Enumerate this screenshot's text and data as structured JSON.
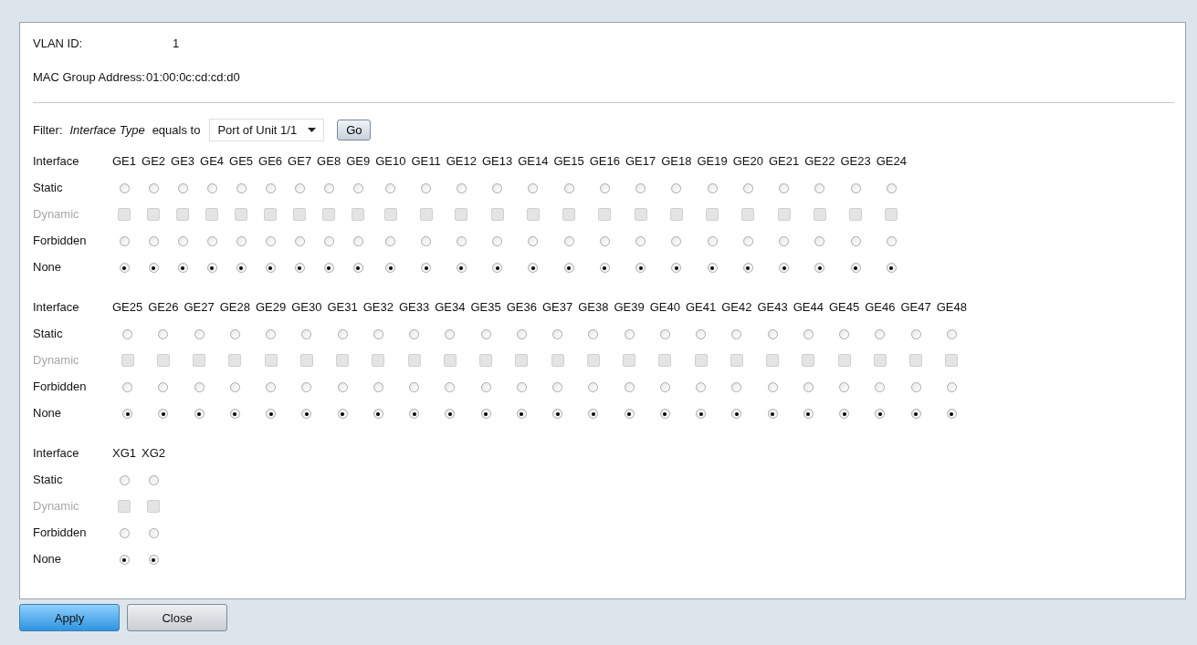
{
  "info": [
    {
      "label": "VLAN ID:",
      "value": "1"
    },
    {
      "label": "MAC Group Address:",
      "value": "01:00:0c:cd:cd:d0"
    }
  ],
  "filter": {
    "label": "Filter:",
    "field": "Interface Type",
    "operator": "equals to",
    "value": "Port of Unit 1/1",
    "button": "Go"
  },
  "groups": [
    {
      "header": "Interface",
      "rows": [
        {
          "label": "Static",
          "disabled": false
        },
        {
          "label": "Dynamic",
          "disabled": true
        },
        {
          "label": "Forbidden",
          "disabled": false
        },
        {
          "label": "None",
          "disabled": false
        }
      ],
      "ports": [
        {
          "name": "GE1",
          "options": [
            false,
            false,
            false,
            true
          ]
        },
        {
          "name": "GE2",
          "options": [
            false,
            false,
            false,
            true
          ]
        },
        {
          "name": "GE3",
          "options": [
            false,
            false,
            false,
            true
          ]
        },
        {
          "name": "GE4",
          "options": [
            false,
            false,
            false,
            true
          ]
        },
        {
          "name": "GE5",
          "options": [
            false,
            false,
            false,
            true
          ]
        },
        {
          "name": "GE6",
          "options": [
            false,
            false,
            false,
            true
          ]
        },
        {
          "name": "GE7",
          "options": [
            false,
            false,
            false,
            true
          ]
        },
        {
          "name": "GE8",
          "options": [
            false,
            false,
            false,
            true
          ]
        },
        {
          "name": "GE9",
          "options": [
            false,
            false,
            false,
            true
          ]
        },
        {
          "name": "GE10",
          "options": [
            false,
            false,
            false,
            true
          ]
        },
        {
          "name": "GE11",
          "options": [
            false,
            false,
            false,
            true
          ]
        },
        {
          "name": "GE12",
          "options": [
            false,
            false,
            false,
            true
          ]
        },
        {
          "name": "GE13",
          "options": [
            false,
            false,
            false,
            true
          ]
        },
        {
          "name": "GE14",
          "options": [
            false,
            false,
            false,
            true
          ]
        },
        {
          "name": "GE15",
          "options": [
            false,
            false,
            false,
            true
          ]
        },
        {
          "name": "GE16",
          "options": [
            false,
            false,
            false,
            true
          ]
        },
        {
          "name": "GE17",
          "options": [
            false,
            false,
            false,
            true
          ]
        },
        {
          "name": "GE18",
          "options": [
            false,
            false,
            false,
            true
          ]
        },
        {
          "name": "GE19",
          "options": [
            false,
            false,
            false,
            true
          ]
        },
        {
          "name": "GE20",
          "options": [
            false,
            false,
            false,
            true
          ]
        },
        {
          "name": "GE21",
          "options": [
            false,
            false,
            false,
            true
          ]
        },
        {
          "name": "GE22",
          "options": [
            false,
            false,
            false,
            true
          ]
        },
        {
          "name": "GE23",
          "options": [
            false,
            false,
            false,
            true
          ]
        },
        {
          "name": "GE24",
          "options": [
            false,
            false,
            false,
            true
          ]
        }
      ]
    },
    {
      "header": "Interface",
      "rows": [
        {
          "label": "Static",
          "disabled": false
        },
        {
          "label": "Dynamic",
          "disabled": true
        },
        {
          "label": "Forbidden",
          "disabled": false
        },
        {
          "label": "None",
          "disabled": false
        }
      ],
      "ports": [
        {
          "name": "GE25",
          "options": [
            false,
            false,
            false,
            true
          ]
        },
        {
          "name": "GE26",
          "options": [
            false,
            false,
            false,
            true
          ]
        },
        {
          "name": "GE27",
          "options": [
            false,
            false,
            false,
            true
          ]
        },
        {
          "name": "GE28",
          "options": [
            false,
            false,
            false,
            true
          ]
        },
        {
          "name": "GE29",
          "options": [
            false,
            false,
            false,
            true
          ]
        },
        {
          "name": "GE30",
          "options": [
            false,
            false,
            false,
            true
          ]
        },
        {
          "name": "GE31",
          "options": [
            false,
            false,
            false,
            true
          ]
        },
        {
          "name": "GE32",
          "options": [
            false,
            false,
            false,
            true
          ]
        },
        {
          "name": "GE33",
          "options": [
            false,
            false,
            false,
            true
          ]
        },
        {
          "name": "GE34",
          "options": [
            false,
            false,
            false,
            true
          ]
        },
        {
          "name": "GE35",
          "options": [
            false,
            false,
            false,
            true
          ]
        },
        {
          "name": "GE36",
          "options": [
            false,
            false,
            false,
            true
          ]
        },
        {
          "name": "GE37",
          "options": [
            false,
            false,
            false,
            true
          ]
        },
        {
          "name": "GE38",
          "options": [
            false,
            false,
            false,
            true
          ]
        },
        {
          "name": "GE39",
          "options": [
            false,
            false,
            false,
            true
          ]
        },
        {
          "name": "GE40",
          "options": [
            false,
            false,
            false,
            true
          ]
        },
        {
          "name": "GE41",
          "options": [
            false,
            false,
            false,
            true
          ]
        },
        {
          "name": "GE42",
          "options": [
            false,
            false,
            false,
            true
          ]
        },
        {
          "name": "GE43",
          "options": [
            false,
            false,
            false,
            true
          ]
        },
        {
          "name": "GE44",
          "options": [
            false,
            false,
            false,
            true
          ]
        },
        {
          "name": "GE45",
          "options": [
            false,
            false,
            false,
            true
          ]
        },
        {
          "name": "GE46",
          "options": [
            false,
            false,
            false,
            true
          ]
        },
        {
          "name": "GE47",
          "options": [
            false,
            false,
            false,
            true
          ]
        },
        {
          "name": "GE48",
          "options": [
            false,
            false,
            false,
            true
          ]
        }
      ]
    },
    {
      "header": "Interface",
      "rows": [
        {
          "label": "Static",
          "disabled": false
        },
        {
          "label": "Dynamic",
          "disabled": true
        },
        {
          "label": "Forbidden",
          "disabled": false
        },
        {
          "label": "None",
          "disabled": false
        }
      ],
      "ports": [
        {
          "name": "XG1",
          "options": [
            false,
            false,
            false,
            true
          ]
        },
        {
          "name": "XG2",
          "options": [
            false,
            false,
            false,
            true
          ]
        }
      ]
    }
  ],
  "buttons": [
    {
      "label": "Apply",
      "kind": "primary"
    },
    {
      "label": "Close",
      "kind": "secondary"
    }
  ]
}
